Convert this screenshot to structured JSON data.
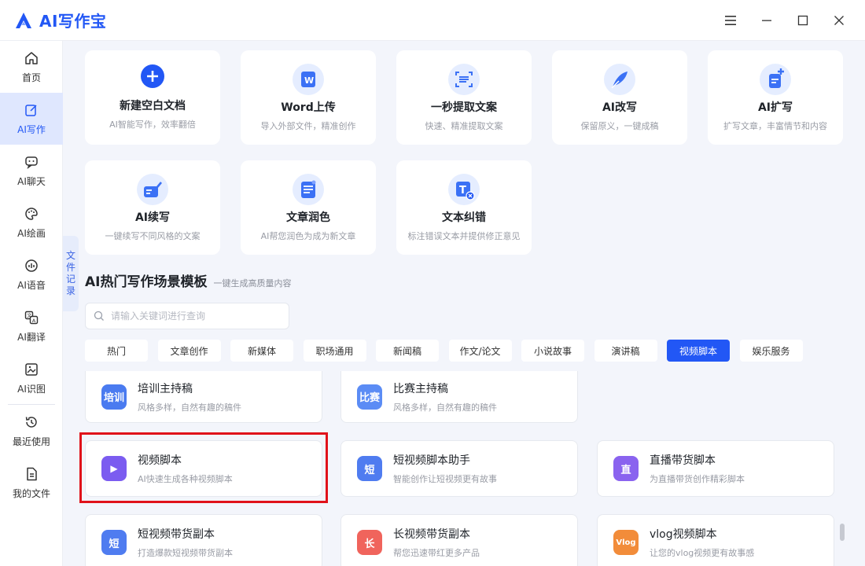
{
  "app": {
    "title": "AI写作宝"
  },
  "colors": {
    "brand": "#2257f5",
    "active_nav_bg": "#dfe7fe",
    "highlight": "#e0121a"
  },
  "sidebar": {
    "items": [
      {
        "label": "首页",
        "icon": "home-icon"
      },
      {
        "label": "AI写作",
        "icon": "edit-icon"
      },
      {
        "label": "AI聊天",
        "icon": "chat-icon"
      },
      {
        "label": "AI绘画",
        "icon": "palette-icon"
      },
      {
        "label": "AI语音",
        "icon": "voice-icon"
      },
      {
        "label": "AI翻译",
        "icon": "translate-icon"
      },
      {
        "label": "AI识图",
        "icon": "image-icon"
      },
      {
        "label": "最近使用",
        "icon": "history-icon"
      },
      {
        "label": "我的文件",
        "icon": "file-icon"
      }
    ],
    "active": "AI写作"
  },
  "doc_tab": {
    "chars": [
      "文",
      "件",
      "记",
      "录"
    ]
  },
  "tools": [
    {
      "title": "新建空白文档",
      "desc": "AI智能写作，效率翻倍"
    },
    {
      "title": "Word上传",
      "desc": "导入外部文件，精准创作"
    },
    {
      "title": "一秒提取文案",
      "desc": "快速、精准提取文案"
    },
    {
      "title": "AI改写",
      "desc": "保留原义，一键成稿"
    },
    {
      "title": "AI扩写",
      "desc": "扩写文章，丰富情节和内容"
    },
    {
      "title": "AI续写",
      "desc": "一键续写不同风格的文案"
    },
    {
      "title": "文章润色",
      "desc": "AI帮您润色为成为新文章"
    },
    {
      "title": "文本纠错",
      "desc": "标注错误文本并提供修正意见"
    }
  ],
  "section": {
    "title": "AI热门写作场景模板",
    "subtitle": "一键生成高质量内容"
  },
  "search": {
    "placeholder": "请输入关键词进行查询",
    "value": ""
  },
  "tabs": [
    "热门",
    "文章创作",
    "新媒体",
    "职场通用",
    "新闻稿",
    "作文/论文",
    "小说故事",
    "演讲稿",
    "视频脚本",
    "娱乐服务"
  ],
  "active_tab": "视频脚本",
  "templates": [
    {
      "title": "培训主持稿",
      "desc": "风格多样，自然有趣的稿件",
      "icon_text": "培训",
      "color": "#4a7bf0"
    },
    {
      "title": "比赛主持稿",
      "desc": "风格多样，自然有趣的稿件",
      "icon_text": "比赛",
      "color": "#5b8cf5"
    },
    {
      "title": "视频脚本",
      "desc": "AI快速生成各种视频脚本",
      "icon_text": "▶",
      "color": "#7b5cf0"
    },
    {
      "title": "短视频脚本助手",
      "desc": "智能创作让短视频更有故事",
      "icon_text": "短",
      "color": "#4f7cf0"
    },
    {
      "title": "直播带货脚本",
      "desc": "为直播带货创作精彩脚本",
      "icon_text": "直",
      "color": "#8a63ef"
    },
    {
      "title": "短视频带货副本",
      "desc": "打造爆款短视频带货副本",
      "icon_text": "短",
      "color": "#4f7cf0"
    },
    {
      "title": "长视频带货副本",
      "desc": "帮您迅速带红更多产品",
      "icon_text": "长",
      "color": "#f0645c"
    },
    {
      "title": "vlog视频脚本",
      "desc": "让您的vlog视频更有故事感",
      "icon_text": "Vlog",
      "color": "#f28c3a"
    }
  ]
}
